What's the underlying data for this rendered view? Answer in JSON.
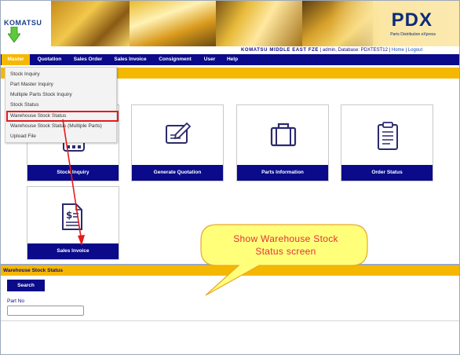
{
  "banner": {
    "logo_text": "KOMATSU",
    "app_title": "PDX",
    "app_subtitle": "Parts Distribution eXpress"
  },
  "company_bar": {
    "company_name": "KOMATSU MIDDLE EAST FZE",
    "user_info": "| admin, Database: PDXTEST12 |",
    "home_link": "Home",
    "separator": "|",
    "logout_link": "Logout"
  },
  "navbar": {
    "items": [
      {
        "label": "Master"
      },
      {
        "label": "Quotation"
      },
      {
        "label": "Sales Order"
      },
      {
        "label": "Sales Invoice"
      },
      {
        "label": "Consignment"
      },
      {
        "label": "User"
      },
      {
        "label": "Help"
      }
    ],
    "active_index": 0
  },
  "dropdown": {
    "items": [
      {
        "label": "Stock Inquiry"
      },
      {
        "label": "Part Master Inquiry"
      },
      {
        "label": "Multiple Parts Stock Inquiry"
      },
      {
        "label": "Stock Status"
      },
      {
        "label": "Warehouse Stock Status"
      },
      {
        "label": "Warehouse Stock Status (Multiple Parts)"
      },
      {
        "label": "Upload File"
      }
    ],
    "highlighted_index": 4
  },
  "tiles": {
    "stock_inquiry": {
      "label": "Stock Inquiry",
      "icon": "calculator-icon"
    },
    "generate_quotation": {
      "label": "Generate Quotation",
      "icon": "tablet-pen-icon"
    },
    "parts_information": {
      "label": "Parts Information",
      "icon": "briefcase-icon"
    },
    "order_status": {
      "label": "Order Status",
      "icon": "clipboard-icon"
    },
    "sales_invoice": {
      "label": "Sales Invoice",
      "icon": "invoice-dollar-icon"
    }
  },
  "callout": {
    "line1": "Show Warehouse  Stock",
    "line2": "Status screen"
  },
  "warehouse_screen": {
    "title": "Warehouse Stock Status",
    "search_label": "Search",
    "part_no_label": "Part No",
    "part_no_value": ""
  },
  "colors": {
    "navy": "#0a0a8a",
    "gold": "#f5b800",
    "highlight_red": "#e41c1c",
    "callout_fill": "#ffff7a",
    "callout_text": "#e0323c"
  }
}
